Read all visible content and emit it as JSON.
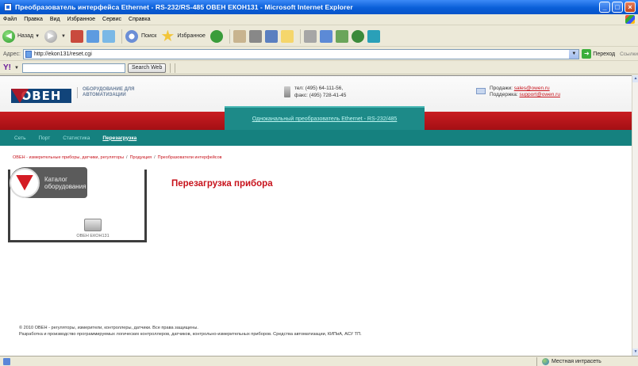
{
  "window": {
    "title": "Преобразователь интерфейса Ethernet - RS-232/RS-485 ОВЕН ЕКОН131 - Microsoft Internet Explorer",
    "buttons": [
      "_",
      "□",
      "×"
    ]
  },
  "menu": [
    "Файл",
    "Правка",
    "Вид",
    "Избранное",
    "Сервис",
    "Справка"
  ],
  "toolbar": {
    "back": "Назад",
    "search": "Поиск",
    "favorites": "Избранное"
  },
  "address": {
    "label": "Адрес:",
    "url": "http://ekon131/reset.cgi",
    "go": "Переход",
    "links": "Ссылки"
  },
  "yahoo": {
    "logo": "Y!",
    "search_button": "Search Web"
  },
  "site": {
    "logo": "ОВЕН",
    "tagline": "Оборудование для автоматизации",
    "phone": "тел: (495) 64-111-56,",
    "fax": "факс: (495) 728-41-45",
    "sales_label": "Продажи:",
    "sales_email": "sales@owen.ru",
    "support_label": "Поддержка:",
    "support_email": "support@owen.ru",
    "device_tab": "Одноканальный преобразователь Ethernet - RS-232/485",
    "nav": [
      "Сеть",
      "Порт",
      "Статистика",
      "Перезагрузка"
    ],
    "breadcrumb": [
      "ОВЕН - измерительные приборы, датчики, регуляторы",
      "Продукция",
      "Преобразователи интерфейсов"
    ],
    "catalog_label_1": "Каталог",
    "catalog_label_2": "оборудования",
    "device_name": "ОВЕН ЕКОН131",
    "page_heading": "Перезагрузка прибора",
    "footer_line1": "© 2010 ОВЕН - регуляторы, измерители, контроллеры, датчики. Все права защищены.",
    "footer_line2": "Разработка и производство программируемых логических контроллеров, датчиков, контрольно-измерительных приборов. Средства автоматизации, КИПиА, АСУ ТП."
  },
  "status": {
    "zone": "Местная интрасеть"
  }
}
